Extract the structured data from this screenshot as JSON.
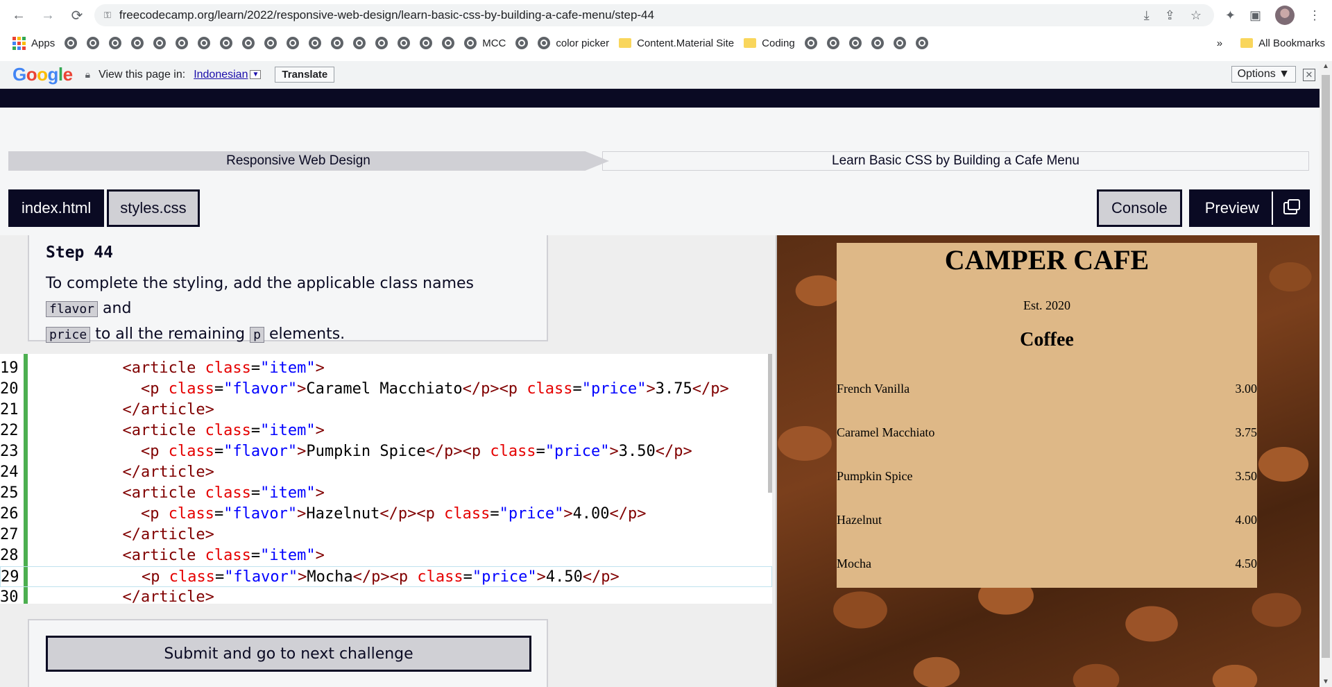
{
  "browser": {
    "url": "freecodecamp.org/learn/2022/responsive-web-design/learn-basic-css-by-building-a-cafe-menu/step-44",
    "bookmarks": {
      "apps_label": "Apps",
      "mcc_label": "MCC",
      "color_picker_label": "color picker",
      "content_material_label": "Content.Material Site",
      "coding_label": "Coding",
      "overflow_label": "»",
      "all_bookmarks_label": "All Bookmarks"
    },
    "translate_bar": {
      "prompt": "View this page in:",
      "language": "Indonesian",
      "translate_button": "Translate",
      "options_button": "Options ▼",
      "close": "✕"
    }
  },
  "breadcrumbs": [
    "Responsive Web Design",
    "Learn Basic CSS by Building a Cafe Menu"
  ],
  "tabs": {
    "file1": "index.html",
    "file2": "styles.css",
    "console": "Console",
    "preview": "Preview"
  },
  "instructions": {
    "title": "Step 44",
    "text_1": "To complete the styling, add the applicable class names",
    "code_1": "flavor",
    "text_2": "and",
    "code_2": "price",
    "text_3": "to all the remaining",
    "code_3": "p",
    "text_4": "elements."
  },
  "code_lines": [
    {
      "n": "19",
      "indent": "          ",
      "kind": "open"
    },
    {
      "n": "20",
      "indent": "            ",
      "kind": "pp",
      "flavor": "Caramel Macchiato",
      "price": "3.75"
    },
    {
      "n": "21",
      "indent": "          ",
      "kind": "close"
    },
    {
      "n": "22",
      "indent": "          ",
      "kind": "open"
    },
    {
      "n": "23",
      "indent": "            ",
      "kind": "pp",
      "flavor": "Pumpkin Spice",
      "price": "3.50"
    },
    {
      "n": "24",
      "indent": "          ",
      "kind": "close"
    },
    {
      "n": "25",
      "indent": "          ",
      "kind": "open"
    },
    {
      "n": "26",
      "indent": "            ",
      "kind": "pp",
      "flavor": "Hazelnut",
      "price": "4.00"
    },
    {
      "n": "27",
      "indent": "          ",
      "kind": "close"
    },
    {
      "n": "28",
      "indent": "          ",
      "kind": "open"
    },
    {
      "n": "29",
      "indent": "            ",
      "kind": "pp",
      "flavor": "Mocha",
      "price": "4.50",
      "active": true
    },
    {
      "n": "30",
      "indent": "          ",
      "kind": "close"
    }
  ],
  "submit_label": "Submit and go to next challenge",
  "preview": {
    "title": "CAMPER CAFE",
    "est": "Est. 2020",
    "section": "Coffee",
    "items": [
      {
        "flavor": "French Vanilla",
        "price": "3.00"
      },
      {
        "flavor": "Caramel Macchiato",
        "price": "3.75"
      },
      {
        "flavor": "Pumpkin Spice",
        "price": "3.50"
      },
      {
        "flavor": "Hazelnut",
        "price": "4.00"
      },
      {
        "flavor": "Mocha",
        "price": "4.50"
      }
    ]
  },
  "colors": {
    "fcc_dark": "#0a0a23",
    "menu_bg": "#deb887",
    "gutter_green": "#4caf50"
  }
}
